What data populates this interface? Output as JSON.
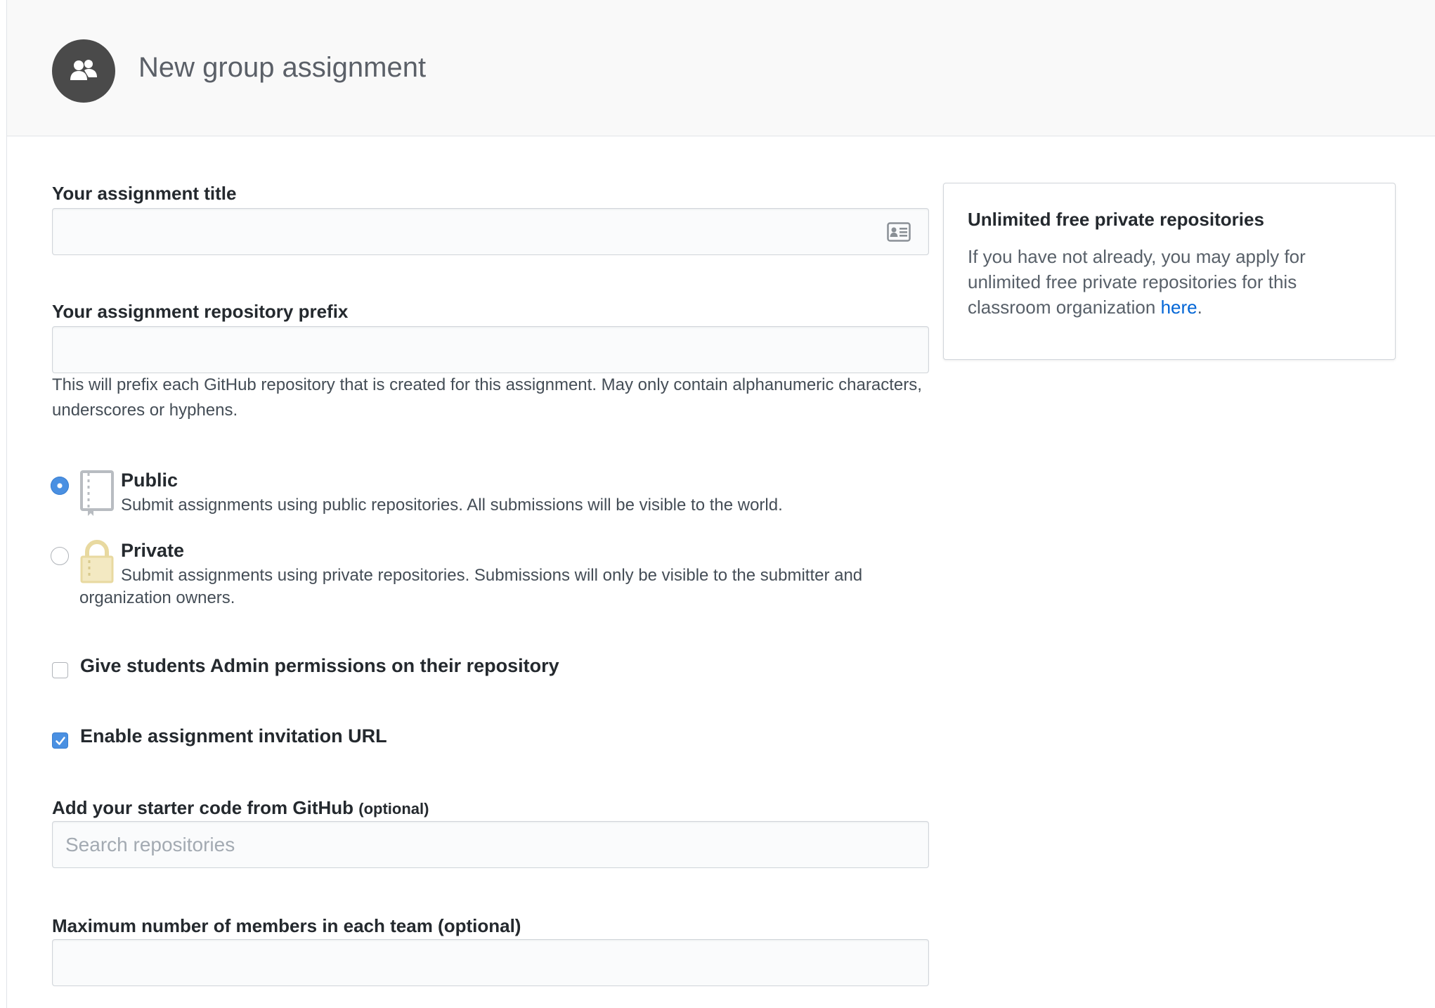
{
  "header": {
    "title": "New group assignment",
    "icon": "people-icon"
  },
  "form": {
    "title_field": {
      "label": "Your assignment title",
      "value": "",
      "placeholder": "",
      "icon": "contact-card-icon"
    },
    "prefix_field": {
      "label": "Your assignment repository prefix",
      "value": "",
      "placeholder": "",
      "help": "This will prefix each GitHub repository that is created for this assignment. May only contain alphanumeric characters, underscores or hyphens."
    },
    "visibility": {
      "selected": "public",
      "options": [
        {
          "id": "public",
          "title": "Public",
          "description": "Submit assignments using public repositories. All submissions will be visible to the world.",
          "icon": "repo-book-icon",
          "checked": true
        },
        {
          "id": "private",
          "title": "Private",
          "description": "Submit assignments using private repositories. Submissions will only be visible to the submitter and organization owners.",
          "icon": "padlock-icon",
          "checked": false
        }
      ]
    },
    "admin_permissions": {
      "label": "Give students Admin permissions on their repository",
      "checked": false
    },
    "invitation_url": {
      "label": "Enable assignment invitation URL",
      "checked": true
    },
    "starter_code": {
      "label": "Add your starter code from GitHub",
      "optional": "(optional)",
      "placeholder": "Search repositories",
      "value": ""
    },
    "max_members": {
      "label": "Maximum number of members in each team (optional)",
      "value": ""
    }
  },
  "sidebar": {
    "title": "Unlimited free private repositories",
    "text": "If you have not already, you may apply for unlimited free private repositories for this classroom organization",
    "link": "here",
    "after_link": "."
  },
  "colors": {
    "accent": "#4a90e2",
    "link": "#0366d6",
    "header_bg": "#f9f9f9",
    "avatar_bg": "#4a4a4a"
  }
}
